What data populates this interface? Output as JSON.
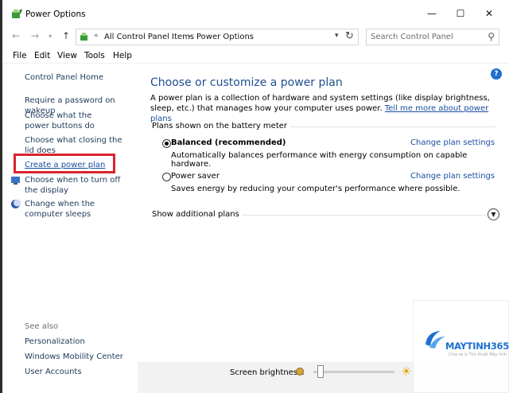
{
  "window": {
    "title": "Power Options",
    "controls": {
      "minimize": "—",
      "maximize": "☐",
      "close": "✕"
    }
  },
  "address": {
    "breadcrumb": [
      "All Control Panel Items",
      "Power Options"
    ],
    "search_placeholder": "Search Control Panel"
  },
  "menu": [
    "File",
    "Edit",
    "View",
    "Tools",
    "Help"
  ],
  "sidebar": {
    "home": "Control Panel Home",
    "links": [
      "Require a password on wakeup",
      "Choose what the power buttons do",
      "Choose what closing the lid does",
      "Create a power plan",
      "Choose when to turn off the display",
      "Change when the computer sleeps"
    ],
    "see_also_label": "See also",
    "see_also": [
      "Personalization",
      "Windows Mobility Center",
      "User Accounts"
    ]
  },
  "main": {
    "heading": "Choose or customize a power plan",
    "description": "A power plan is a collection of hardware and system settings (like display brightness, sleep, etc.) that manages how your computer uses power. ",
    "learn_more": "Tell me more about power plans",
    "plans_label": "Plans shown on the battery meter",
    "plans": [
      {
        "name": "Balanced (recommended)",
        "description": "Automatically balances performance with energy consumption on capable hardware.",
        "link": "Change plan settings",
        "selected": true
      },
      {
        "name": "Power saver",
        "description": "Saves energy by reducing your computer's performance where possible.",
        "link": "Change plan settings",
        "selected": false
      }
    ],
    "show_additional": "Show additional plans"
  },
  "bottom": {
    "brightness_label": "Screen brightness:",
    "brightness_level": 0.05
  },
  "watermark": {
    "brand": "MAYTINH365",
    "tagline": "Chia sẻ & Thủ thuật Máy tính"
  },
  "colors": {
    "link": "#1a4ea0",
    "heading": "#1e4f91",
    "highlight": "#d9232f"
  }
}
